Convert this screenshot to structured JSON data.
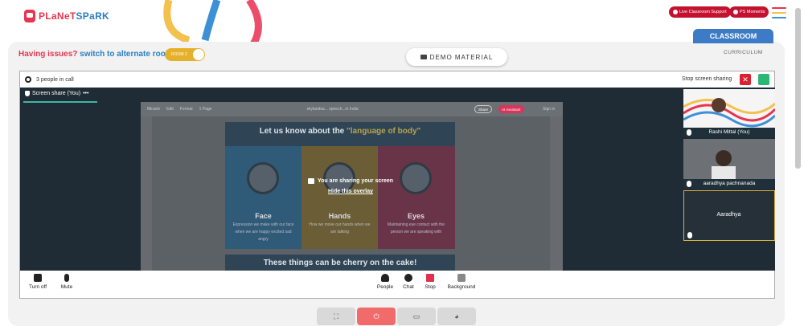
{
  "brand": {
    "logo_text_1": "PLaNeT",
    "logo_text_2": "SPaRK"
  },
  "header": {
    "live_support": "Live Classroom Support",
    "ps_moments": "PS Moments"
  },
  "issue": {
    "text": "Having issues?",
    "link": "switch to alternate room",
    "toggle_label": "ROOM 2"
  },
  "demo_material": "DEMO MATERIAL",
  "tabs": {
    "classroom": "CLASSROOM",
    "curriculum": "CURRICULUM"
  },
  "call": {
    "people_count": "3 people in call",
    "stop_share": "Stop screen sharing",
    "screen_share_tab": "Screen share (You)",
    "overlay_msg": "You are sharing your screen",
    "overlay_hide": "Hide this overlay"
  },
  "shared_screen": {
    "toolbar": [
      "Miracle",
      "Edit",
      "Format",
      "1 Page"
    ],
    "doc_title": "skylandsa... speech...in India",
    "share_btn": "Share",
    "ai_btn": "AI Assistant",
    "sign_in": "Sign in",
    "slide_title_1": "Let us know about the ",
    "slide_title_2": "\"language of body\"",
    "columns": [
      {
        "title": "Face",
        "desc": "Expression we make with our face when we are happy excited sad angry",
        "color": "#2b7fb0"
      },
      {
        "title": "Hands",
        "desc": "How we move our hands when we are talking",
        "color": "#e6a91f"
      },
      {
        "title": "Eyes",
        "desc": "Maintaining eye contact with the person we are speaking with",
        "color": "#d9345a"
      }
    ],
    "slide2_title": "These things can be cherry on the cake!"
  },
  "participants": [
    {
      "name": "Rashi Mittal (You)"
    },
    {
      "name": "aaradhya pachnanada"
    },
    {
      "name": "Aaradhya"
    }
  ],
  "controls": {
    "turn_off": "Turn off",
    "mute": "Mute",
    "people": "People",
    "chat": "Chat",
    "stop": "Stop",
    "background": "Background"
  },
  "colors": {
    "accent": "#e8344e",
    "blue": "#2a7fc0",
    "brand_red": "#c4112f"
  }
}
